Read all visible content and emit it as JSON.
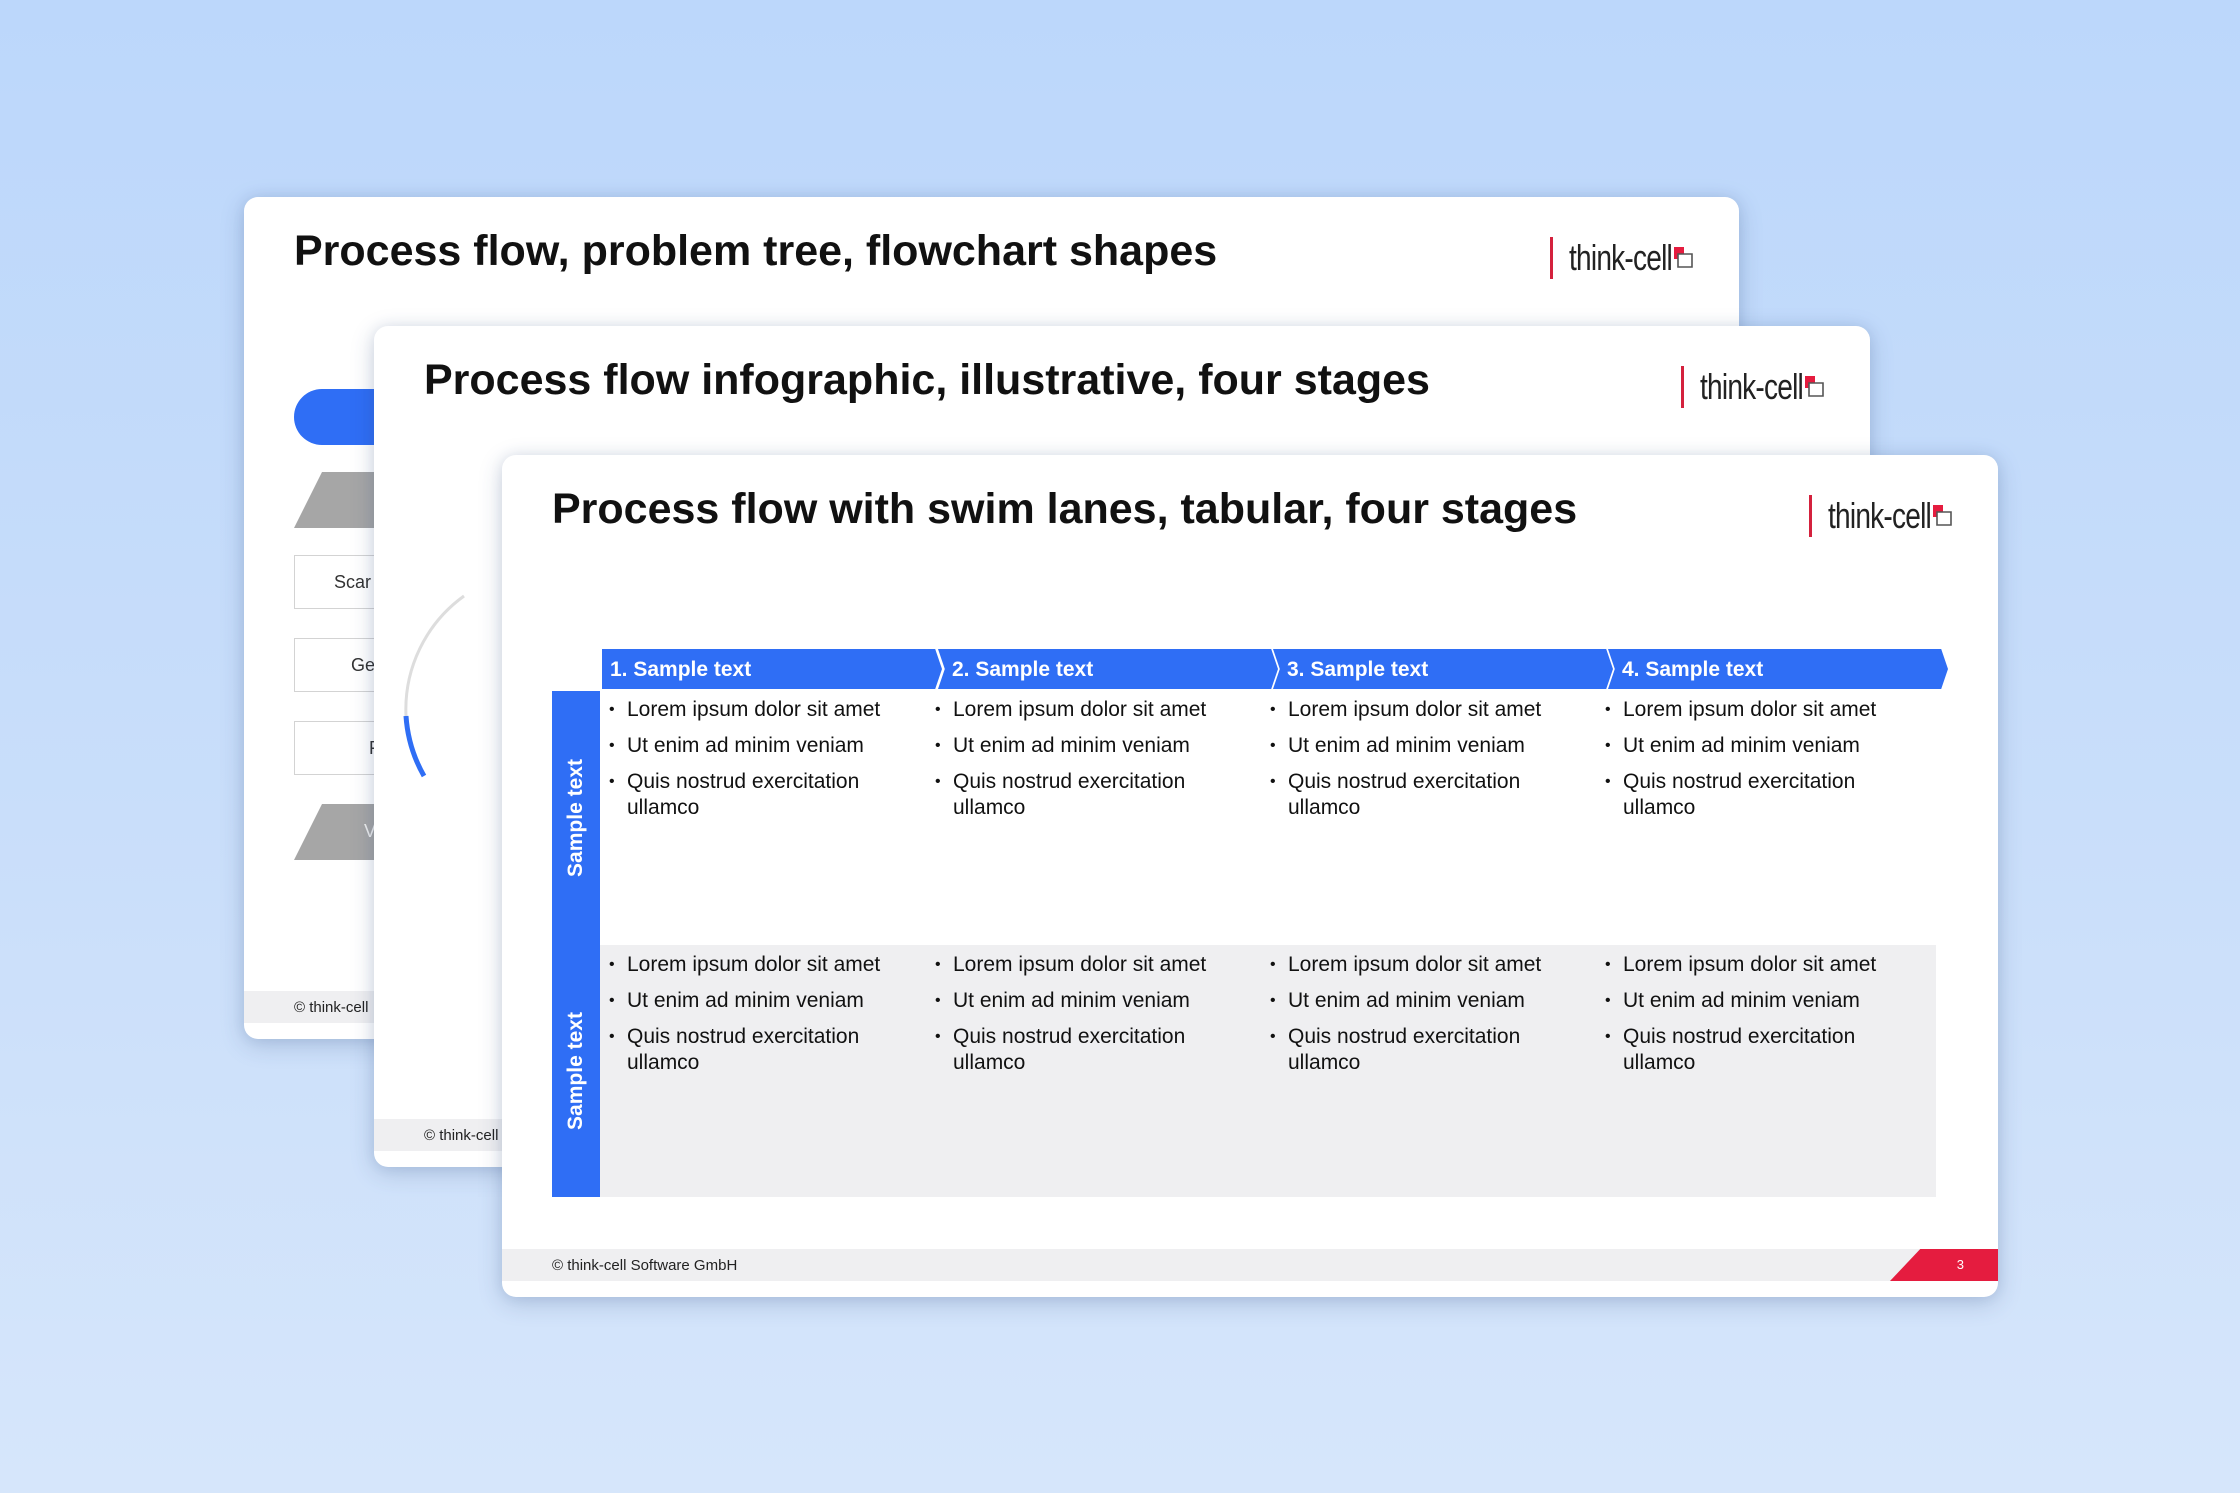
{
  "colors": {
    "background": "#c4dcfb",
    "accent_blue": "#2f6ef5",
    "brand_red": "#e51c3f",
    "lane_gray": "#efeff1"
  },
  "brand": {
    "name": "think-cell",
    "icon": "think-cell-logo-icon"
  },
  "slides": [
    {
      "title": "Process flow, problem tree, flowchart shapes",
      "footer": "© think-cell",
      "shape_fragments": [
        "Scar",
        "Ge",
        "F",
        "V"
      ]
    },
    {
      "title": "Process flow infographic, illustrative, four stages",
      "footer": "© think-cell"
    },
    {
      "title": "Process flow with swim lanes, tabular, four stages",
      "footer": "© think-cell Software GmbH",
      "page_number": "3",
      "stages": [
        "1. Sample text",
        "2. Sample text",
        "3. Sample text",
        "4. Sample text"
      ],
      "lanes": [
        {
          "label": "Sample text",
          "cells": [
            [
              "Lorem ipsum dolor sit amet",
              "Ut enim ad minim veniam",
              "Quis nostrud exercitation ullamco"
            ],
            [
              "Lorem ipsum dolor sit amet",
              "Ut enim ad minim veniam",
              "Quis nostrud exercitation ullamco"
            ],
            [
              "Lorem ipsum dolor sit amet",
              "Ut enim ad minim veniam",
              "Quis nostrud exercitation ullamco"
            ],
            [
              "Lorem ipsum dolor sit amet",
              "Ut enim ad minim veniam",
              "Quis nostrud exercitation ullamco"
            ]
          ]
        },
        {
          "label": "Sample text",
          "cells": [
            [
              "Lorem ipsum dolor sit amet",
              "Ut enim ad minim veniam",
              "Quis nostrud exercitation ullamco"
            ],
            [
              "Lorem ipsum dolor sit amet",
              "Ut enim ad minim veniam",
              "Quis nostrud exercitation ullamco"
            ],
            [
              "Lorem ipsum dolor sit amet",
              "Ut enim ad minim veniam",
              "Quis nostrud exercitation ullamco"
            ],
            [
              "Lorem ipsum dolor sit amet",
              "Ut enim ad minim veniam",
              "Quis nostrud exercitation ullamco"
            ]
          ]
        }
      ]
    }
  ]
}
